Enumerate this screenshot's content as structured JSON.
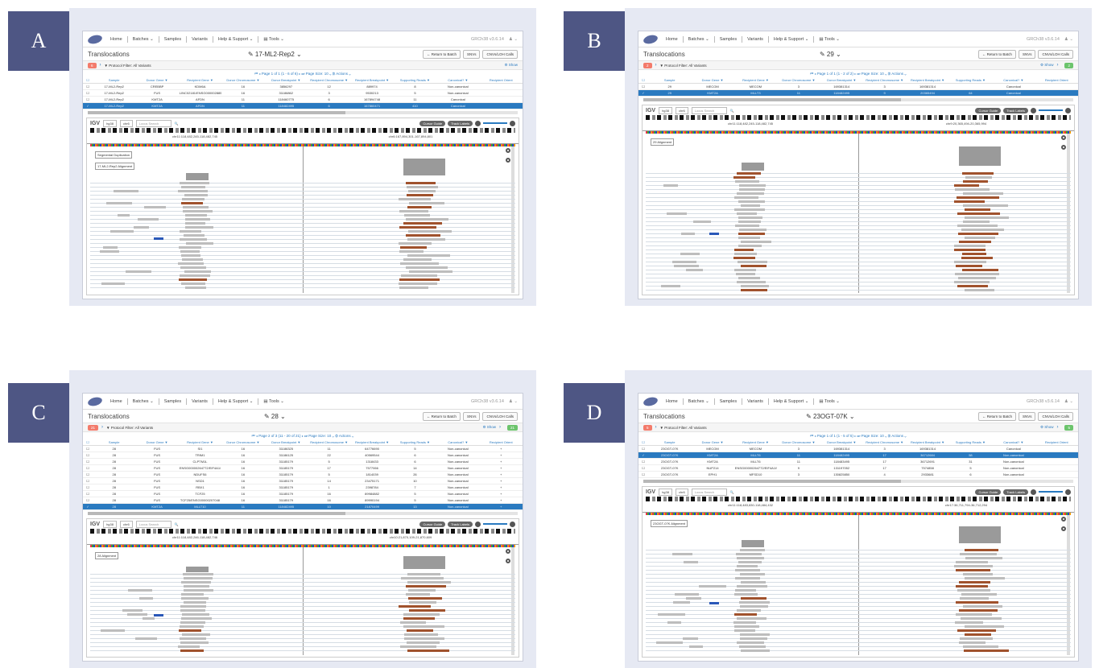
{
  "app": {
    "nav_items": [
      "Home",
      "Batches ⌄",
      "Samples",
      "Variants",
      "Help & Support ⌄",
      "▤ Tools ⌄"
    ],
    "page_title": "Translocations",
    "filter_text": "▼ Protocol Filter: All Variants",
    "show_label": "⚙ Show",
    "buttons": [
      "← Return to Batch",
      "SNVs",
      "CNVs/LOH Calls"
    ],
    "columns": [
      "Sample",
      "Donor Gene ▼",
      "Recipient Gene ▼",
      "Donor Chromosome ▼",
      "Donor Breakpoint ▼",
      "Recipient Chromosome ▼",
      "Recipient Breakpoint ▼",
      "Supporting Reads ▼",
      "Canonical? ▼",
      "Recipient Orient"
    ],
    "igv": {
      "logo": "IGV",
      "genome": "hg38",
      "chrom": "chr6",
      "search_placeholder": "Locus Search",
      "cursor_guide": "Cursor Guide",
      "track_labels": "Track Labels"
    }
  },
  "panels": [
    {
      "letter": "A",
      "version": "GRCh38   v3.6.14",
      "sample_title": "✎ 17-ML2-Rep2 ⌄",
      "count_left": "6",
      "count_right": "",
      "pager": "⏮  ◂   Page 1 of 1 (1 - 6 of 6)   ▸  ⏭     Page Size: 10 ⌄   ⚙ Actions ⌄",
      "rows": [
        [
          "17-ML2-Rep2",
          "CREBBP",
          "KDM6A",
          "16",
          "3856297",
          "12",
          "889974",
          "8",
          "Non-canonical",
          ""
        ],
        [
          "17-ML2-Rep2",
          "FUS",
          "LINC02181/ENSG00000288593",
          "16",
          "31186862",
          "3",
          "9530213",
          "5",
          "Non-canonical",
          ""
        ],
        [
          "17-ML2-Rep2",
          "KMT2A",
          "AFDN",
          "11",
          "118460775",
          "6",
          "167894748",
          "11",
          "Canonical",
          ""
        ],
        [
          "17-ML2-Rep2",
          "KMT2A",
          "AFDN",
          "11",
          "118482495",
          "6",
          "167860471",
          "410",
          "Canonical",
          ""
        ]
      ],
      "selected_row": 3,
      "loci": [
        "chr11:118,482,245-118,482,745",
        "chr6:167,894,301-167,894,801"
      ],
      "track_labels": [
        "Segmental Duplication",
        "17-ML2-Rep2 Alignment"
      ]
    },
    {
      "letter": "B",
      "version": "GRCh38   v3.6.14",
      "sample_title": "✎ 29 ⌄",
      "count_left": "2",
      "count_right": "2",
      "pager": "⏮  ◂   Page 1 of 1 (1 - 2 of 2)   ▸  ⏭     Page Size: 10 ⌄   ⚙ Actions ⌄",
      "rows": [
        [
          "29",
          "MECOM",
          "MECOM",
          "3",
          "169381314",
          "3",
          "169381314",
          "",
          "Canonical",
          ""
        ],
        [
          "29",
          "KMT2A",
          "MLLT3",
          "11",
          "118482495",
          "9",
          "20365494",
          "64",
          "Canonical",
          ""
        ]
      ],
      "selected_row": 1,
      "loci": [
        "chr11:118,482,245-118,482,745",
        "chr9:20,365,494-20,365,994"
      ],
      "track_labels": [
        "29 Alignment"
      ]
    },
    {
      "letter": "C",
      "version": "GRCh38   v3.6.14",
      "sample_title": "✎ 28 ⌄",
      "count_left": "21",
      "count_right": "21",
      "pager": "⏮  ◂   Page 2 of 3 (11 - 20 of 21)   ▸  ⏭     Page Size: 10 ⌄   ⚙ Actions ⌄",
      "rows": [
        [
          "28",
          "FUS",
          "SI1",
          "16",
          "31186325",
          "11",
          "64776690",
          "5",
          "Non-canonical",
          "+"
        ],
        [
          "28",
          "FUS",
          "TRIM1",
          "16",
          "31186125",
          "22",
          "40569544",
          "6",
          "Non-canonical",
          "+"
        ],
        [
          "28",
          "FUS",
          "CLPTM1L",
          "16",
          "31185179",
          "5",
          "1318433",
          "6",
          "Non-canonical",
          "+"
        ],
        [
          "28",
          "FUS",
          "ENSG00000264772/EIF4A1/",
          "16",
          "31185179",
          "17",
          "7577066",
          "14",
          "Non-canonical",
          "+"
        ],
        [
          "28",
          "FUS",
          "NDUFS6",
          "16",
          "31185179",
          "5",
          "1814039",
          "26",
          "Non-canonical",
          "+"
        ],
        [
          "28",
          "FUS",
          "NSD1",
          "16",
          "31185179",
          "14",
          "23475171",
          "10",
          "Non-canonical",
          "+"
        ],
        [
          "28",
          "FUS",
          "RBX1",
          "16",
          "31185179",
          "1",
          "2398784",
          "7",
          "Non-canonical",
          "+"
        ],
        [
          "28",
          "FUS",
          "TCF25",
          "16",
          "31185179",
          "16",
          "89984882",
          "5",
          "Non-canonical",
          "+"
        ],
        [
          "28",
          "FUS",
          "TCF25/ENSG00000207048",
          "16",
          "31185179",
          "16",
          "89990194",
          "5",
          "Non-canonical",
          "+"
        ],
        [
          "28",
          "KMT2A",
          "MLLT10",
          "11",
          "118482495",
          "10",
          "21870499",
          "13",
          "Non-canonical",
          "+"
        ]
      ],
      "selected_row": 9,
      "loci": [
        "chr11:118,482,246-118,482,746",
        "chr10:21,870,109-21,870,609"
      ],
      "track_labels": [
        "28 Alignment"
      ]
    },
    {
      "letter": "D",
      "version": "GRCh38   v3.6.14",
      "sample_title": "✎ 23OGT-07K ⌄",
      "count_left": "5",
      "count_right": "5",
      "pager": "⏮  ◂   Page 1 of 1 (1 - 5 of 5)   ▸  ⏭     Page Size: 10 ⌄   ⚙ Actions ⌄",
      "rows": [
        [
          "23OGT-07K",
          "MECOM",
          "MECOM",
          "3",
          "169381314",
          "3",
          "169381314",
          "",
          "Canonical",
          ""
        ],
        [
          "23OGT-07K",
          "KMT2A",
          "MLLT6",
          "11",
          "118482495",
          "17",
          "36712684",
          "58",
          "Non-canonical",
          ""
        ],
        [
          "23OGT-07K",
          "KMT2A",
          "MLLT6",
          "11",
          "118483495",
          "17",
          "36712691",
          "31",
          "Non-canonical",
          ""
        ],
        [
          "23OGT-07K",
          "NUP214",
          "ENSG00000264772/EIF4A1/SENP3-EIF4A1",
          "9",
          "131197052",
          "17",
          "7574858",
          "5",
          "Non-canonical",
          ""
        ],
        [
          "23OGT-07K",
          "EPH1",
          "MFSD10",
          "3",
          "130825850",
          "4",
          "2933681",
          "6",
          "Non-canonical",
          ""
        ]
      ],
      "selected_row": 1,
      "loci": [
        "chr11:118,483,830-118,484,432",
        "chr17:36,711,794-36,712,294"
      ],
      "track_labels": [
        "23OGT-07K Alignment"
      ]
    }
  ]
}
